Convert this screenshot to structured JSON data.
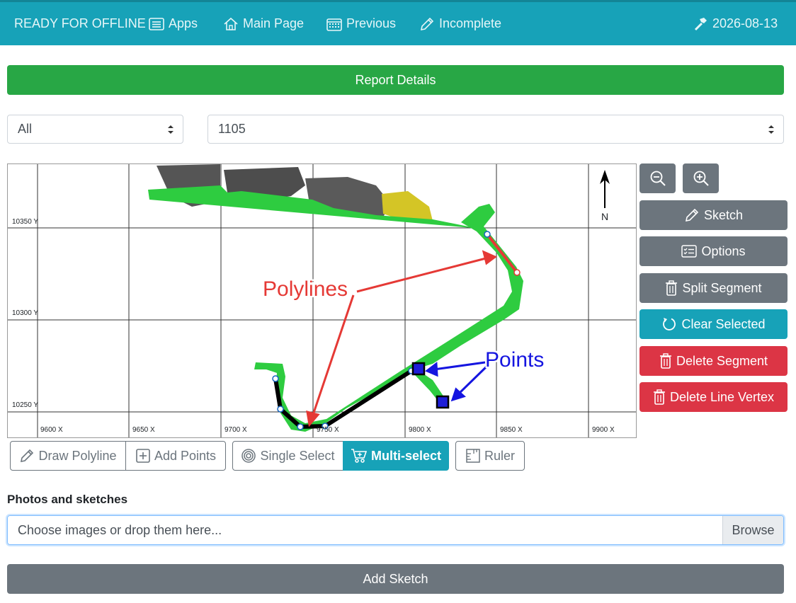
{
  "navbar": {
    "offline_label": "READY FOR OFFLINE",
    "apps": "Apps",
    "main_page": "Main Page",
    "previous": "Previous",
    "incomplete": "Incomplete",
    "date": "2026-08-13",
    "bg_color": "#17a2b8"
  },
  "report_details": "Report Details",
  "filters": {
    "left_value": "All",
    "right_value": "1105"
  },
  "map": {
    "y_labels": [
      "10350 Y",
      "10300 Y",
      "10250 Y"
    ],
    "x_labels": [
      "9600 X",
      "9650 X",
      "9700 X",
      "9750 X",
      "9800 X",
      "9850 X",
      "9900 X"
    ],
    "north": "N",
    "annotation_polylines": "Polylines",
    "annotation_points": "Points"
  },
  "side_buttons": {
    "zoom_out_icon": "zoom-out-icon",
    "zoom_in_icon": "zoom-in-icon",
    "sketch": "Sketch",
    "options": "Options",
    "split_segment": "Split Segment",
    "clear_selected": "Clear Selected",
    "delete_segment": "Delete Segment",
    "delete_line_vertex": "Delete Line Vertex"
  },
  "toolbar": {
    "draw_polyline": "Draw Polyline",
    "add_points": "Add Points",
    "single_select": "Single Select",
    "multi_select": "Multi-select",
    "ruler": "Ruler"
  },
  "photos": {
    "label": "Photos and sketches",
    "placeholder": "Choose images or drop them here...",
    "browse": "Browse"
  },
  "add_sketch": "Add Sketch",
  "colors": {
    "success": "#28a745",
    "secondary": "#6c757d",
    "info": "#17a2b8",
    "danger": "#dc3545"
  }
}
